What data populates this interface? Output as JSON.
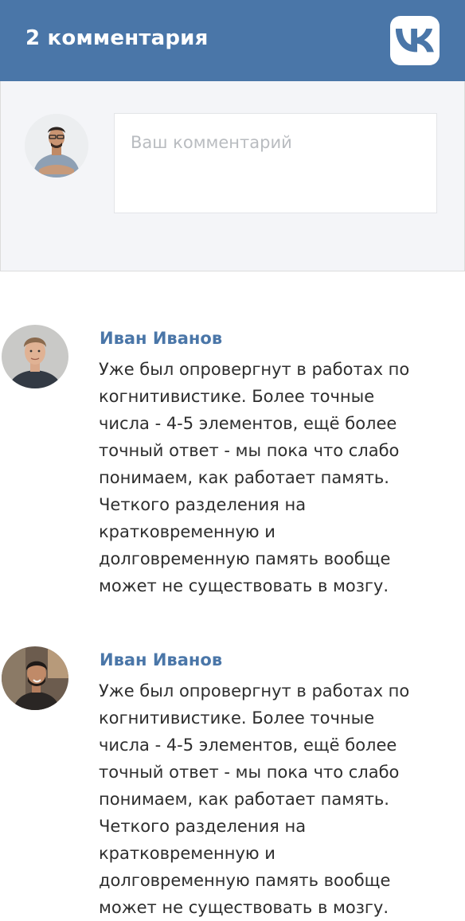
{
  "header": {
    "title": "2 комментария",
    "logo_icon": "vk-logo-icon",
    "background": "#4a76a8"
  },
  "compose": {
    "avatar_icon": "user-avatar",
    "placeholder": "Ваш комментарий",
    "value": ""
  },
  "comments": [
    {
      "author": "Иван Иванов",
      "avatar_icon": "user-avatar",
      "lines": [
        "Уже был опровергнут в работах по",
        "когнитивистике. Более точные",
        "числа - 4-5 элементов, ещё более",
        "точный ответ - мы пока что слабо",
        "понимаем, как работает память.",
        "Четкого разделения на",
        "кратковременную и",
        "долговременную память вообще",
        "может не существовать в мозгу."
      ]
    },
    {
      "author": "Иван Иванов",
      "avatar_icon": "user-avatar",
      "lines": [
        "Уже был опровергнут в работах по",
        "когнитивистике. Более точные",
        "числа - 4-5 элементов, ещё более",
        "точный ответ - мы пока что слабо",
        "понимаем, как работает память.",
        "Четкого разделения на",
        "кратковременную и",
        "долговременную память вообще",
        "может не существовать в мозгу."
      ]
    }
  ]
}
